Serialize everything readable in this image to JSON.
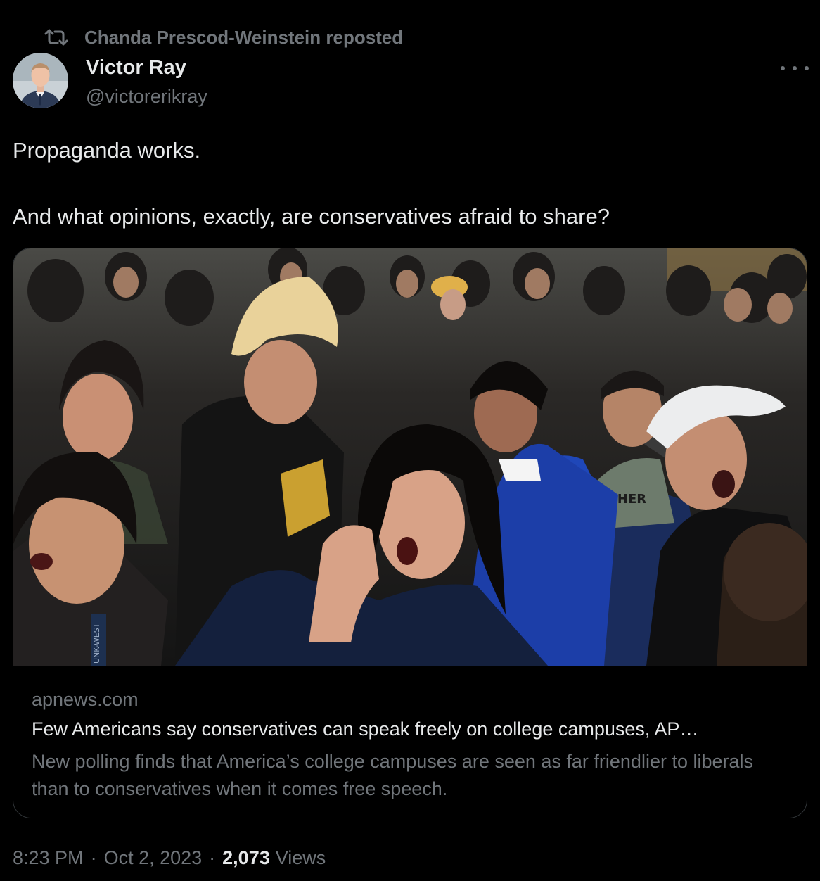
{
  "repost": {
    "text": "Chanda Prescod-Weinstein reposted",
    "icon": "repost-icon"
  },
  "author": {
    "name": "Victor Ray",
    "handle": "@victorerikray",
    "avatar": "avatar"
  },
  "menu": {
    "icon": "more-icon"
  },
  "post": {
    "lines": [
      "Propaganda works.",
      "And what opinions, exactly, are conservatives afraid to share?"
    ]
  },
  "card": {
    "domain": "apnews.com",
    "title": "Few Americans say conservatives can speak freely on college campuses, AP…",
    "description": "New polling finds that America’s college campuses are seen as far friendlier to liberals than to conservatives when it comes free speech.",
    "shirt_text": "ASHER",
    "badge_text": "UNK-WEST"
  },
  "meta": {
    "time": "8:23 PM",
    "sep1": "·",
    "date": "Oct 2, 2023",
    "sep2": "·",
    "views_count": "2,073",
    "views_label": "Views"
  },
  "colors": {
    "background": "#000000",
    "text": "#e7e9ea",
    "secondary": "#71767b",
    "border": "#2f3336"
  }
}
